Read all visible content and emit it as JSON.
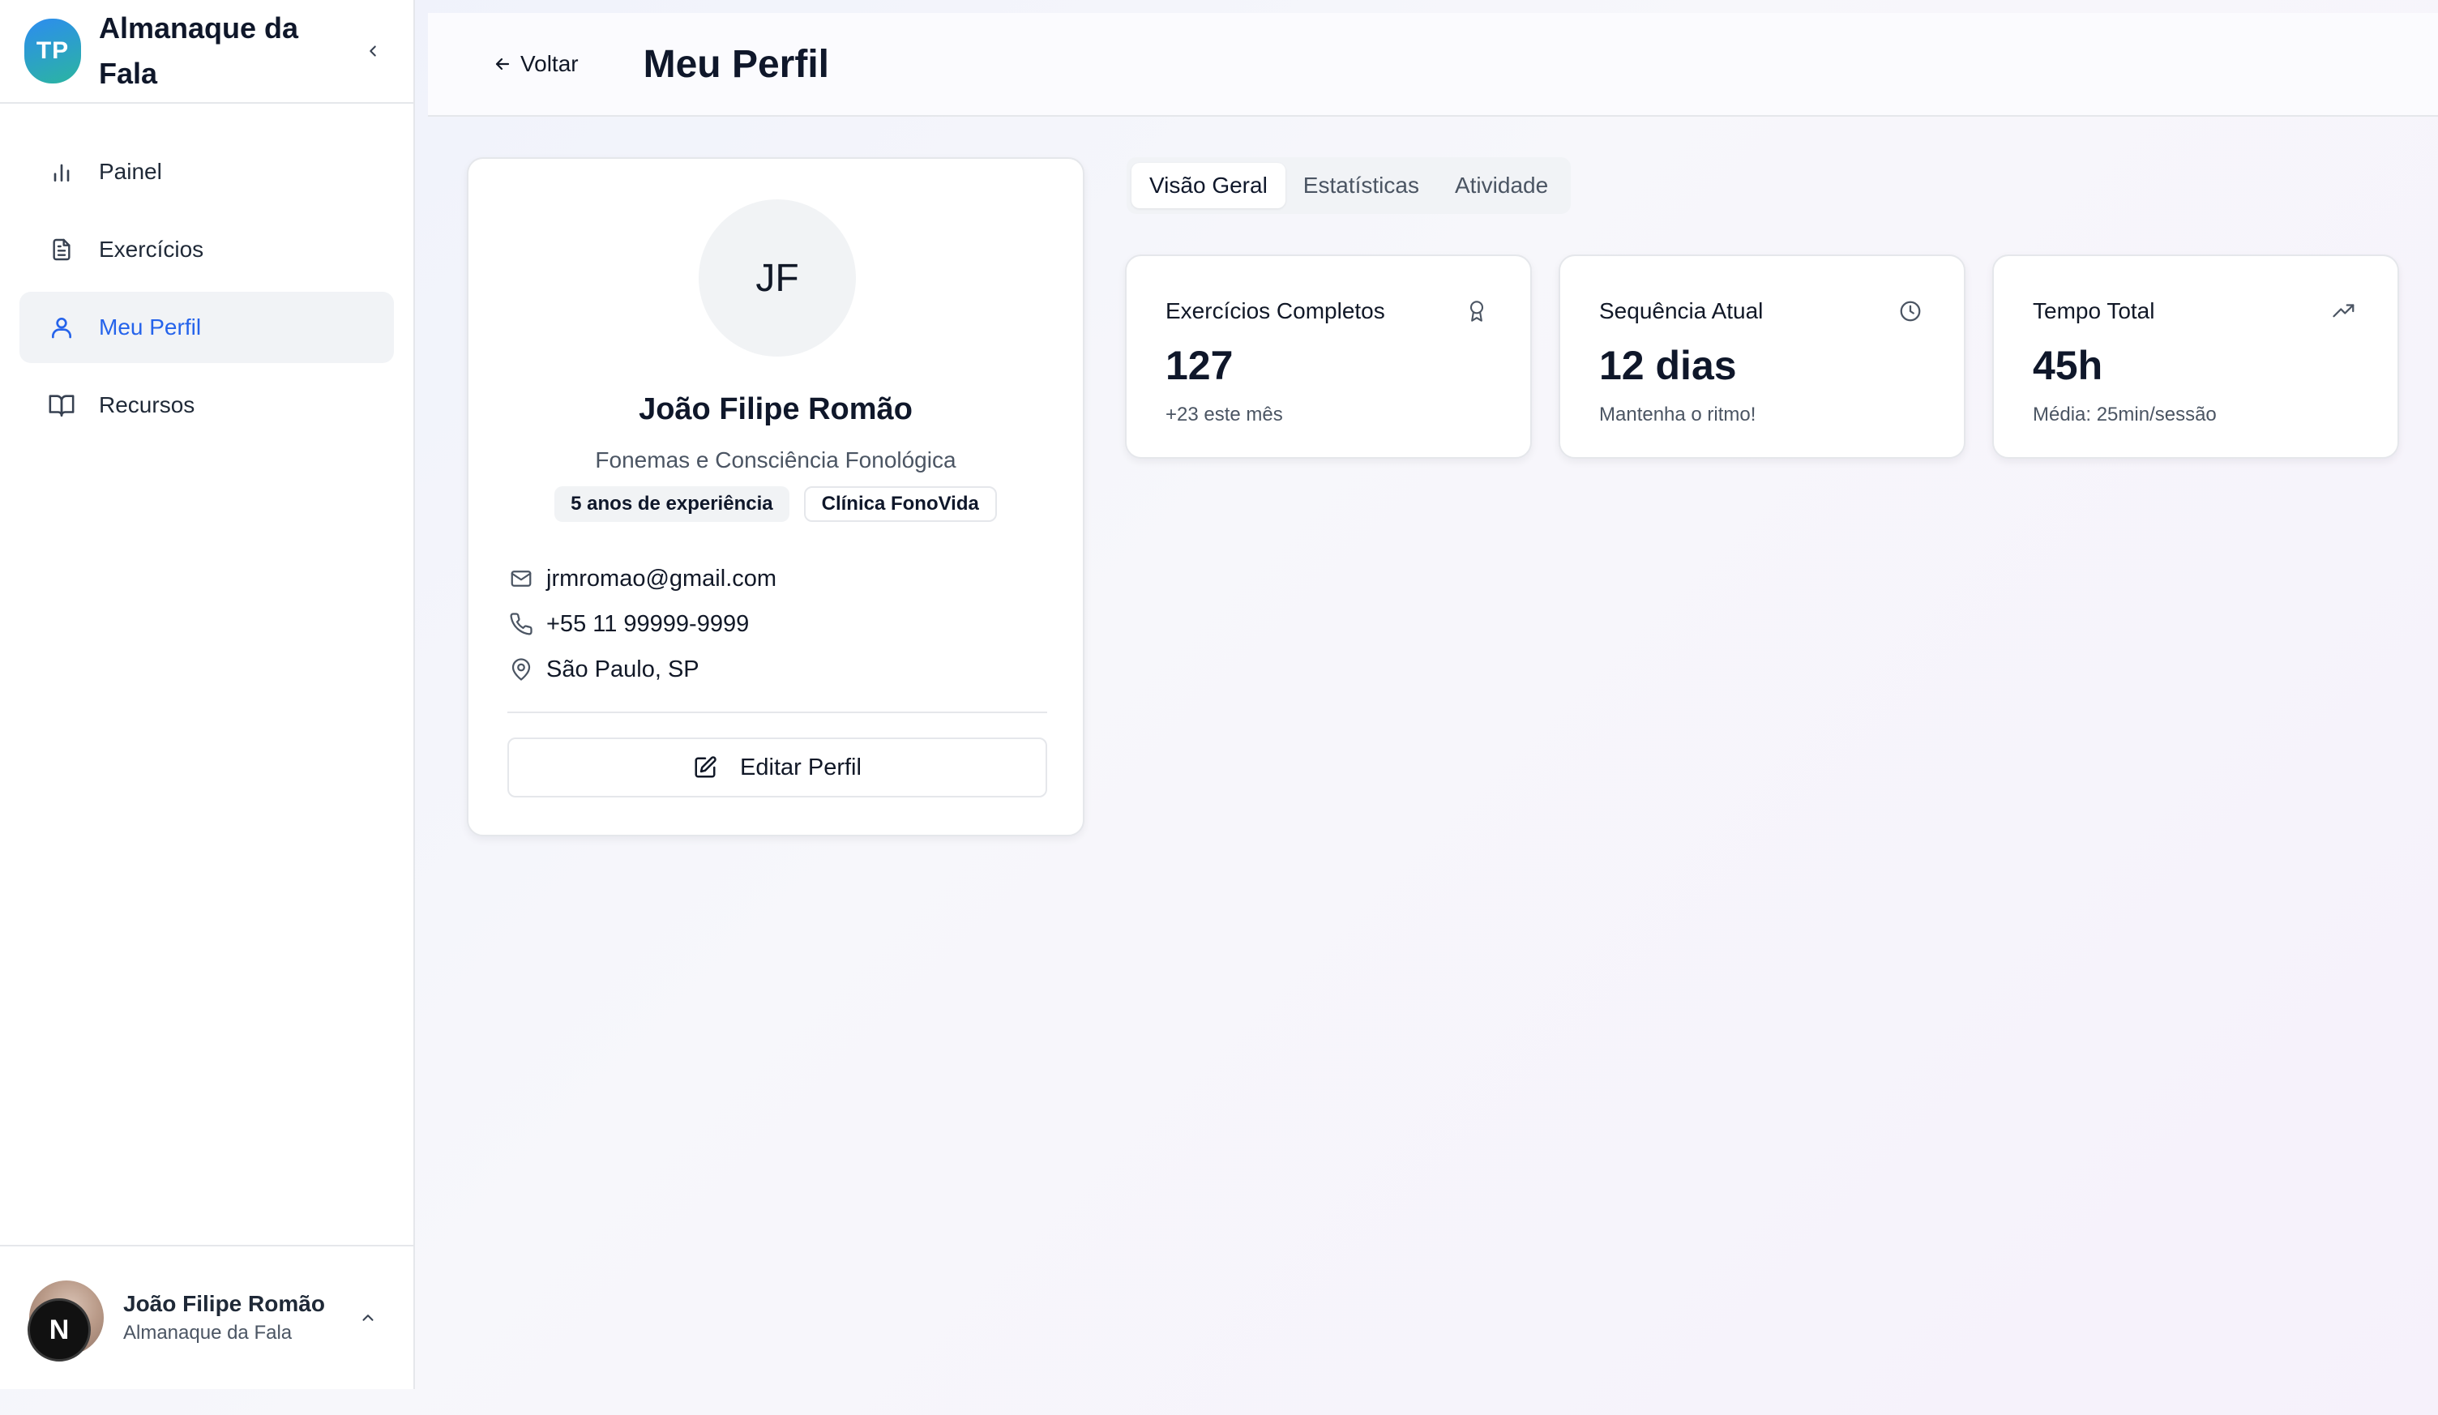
{
  "app": {
    "logo_text": "TP",
    "title": "Almanaque da Fala"
  },
  "sidebar": {
    "items": [
      {
        "label": "Painel",
        "icon": "bar-chart-icon"
      },
      {
        "label": "Exercícios",
        "icon": "document-icon"
      },
      {
        "label": "Meu Perfil",
        "icon": "user-icon",
        "active": true
      },
      {
        "label": "Recursos",
        "icon": "book-icon"
      }
    ],
    "footer": {
      "name": "João Filipe Romão",
      "org": "Almanaque da Fala",
      "badge": "N"
    }
  },
  "header": {
    "back_label": "Voltar",
    "title": "Meu Perfil"
  },
  "profile": {
    "initials": "JF",
    "name": "João Filipe Romão",
    "specialty": "Fonemas e Consciência Fonológica",
    "badges": [
      "5 anos de experiência",
      "Clínica FonoVida"
    ],
    "email": "jrmromao@gmail.com",
    "phone": "+55 11 99999-9999",
    "location": "São Paulo, SP",
    "edit_label": "Editar Perfil"
  },
  "tabs": [
    {
      "label": "Visão Geral",
      "active": true
    },
    {
      "label": "Estatísticas"
    },
    {
      "label": "Atividade"
    }
  ],
  "stats": [
    {
      "title": "Exercícios Completos",
      "value": "127",
      "sub": "+23 este mês",
      "icon": "award-icon"
    },
    {
      "title": "Sequência Atual",
      "value": "12 dias",
      "sub": "Mantenha o ritmo!",
      "icon": "clock-icon"
    },
    {
      "title": "Tempo Total",
      "value": "45h",
      "sub": "Média: 25min/sessão",
      "icon": "trending-up-icon"
    }
  ],
  "colors": {
    "accent": "#2563eb",
    "logo_from": "#2d8cf0",
    "logo_to": "#2bb5a0"
  }
}
